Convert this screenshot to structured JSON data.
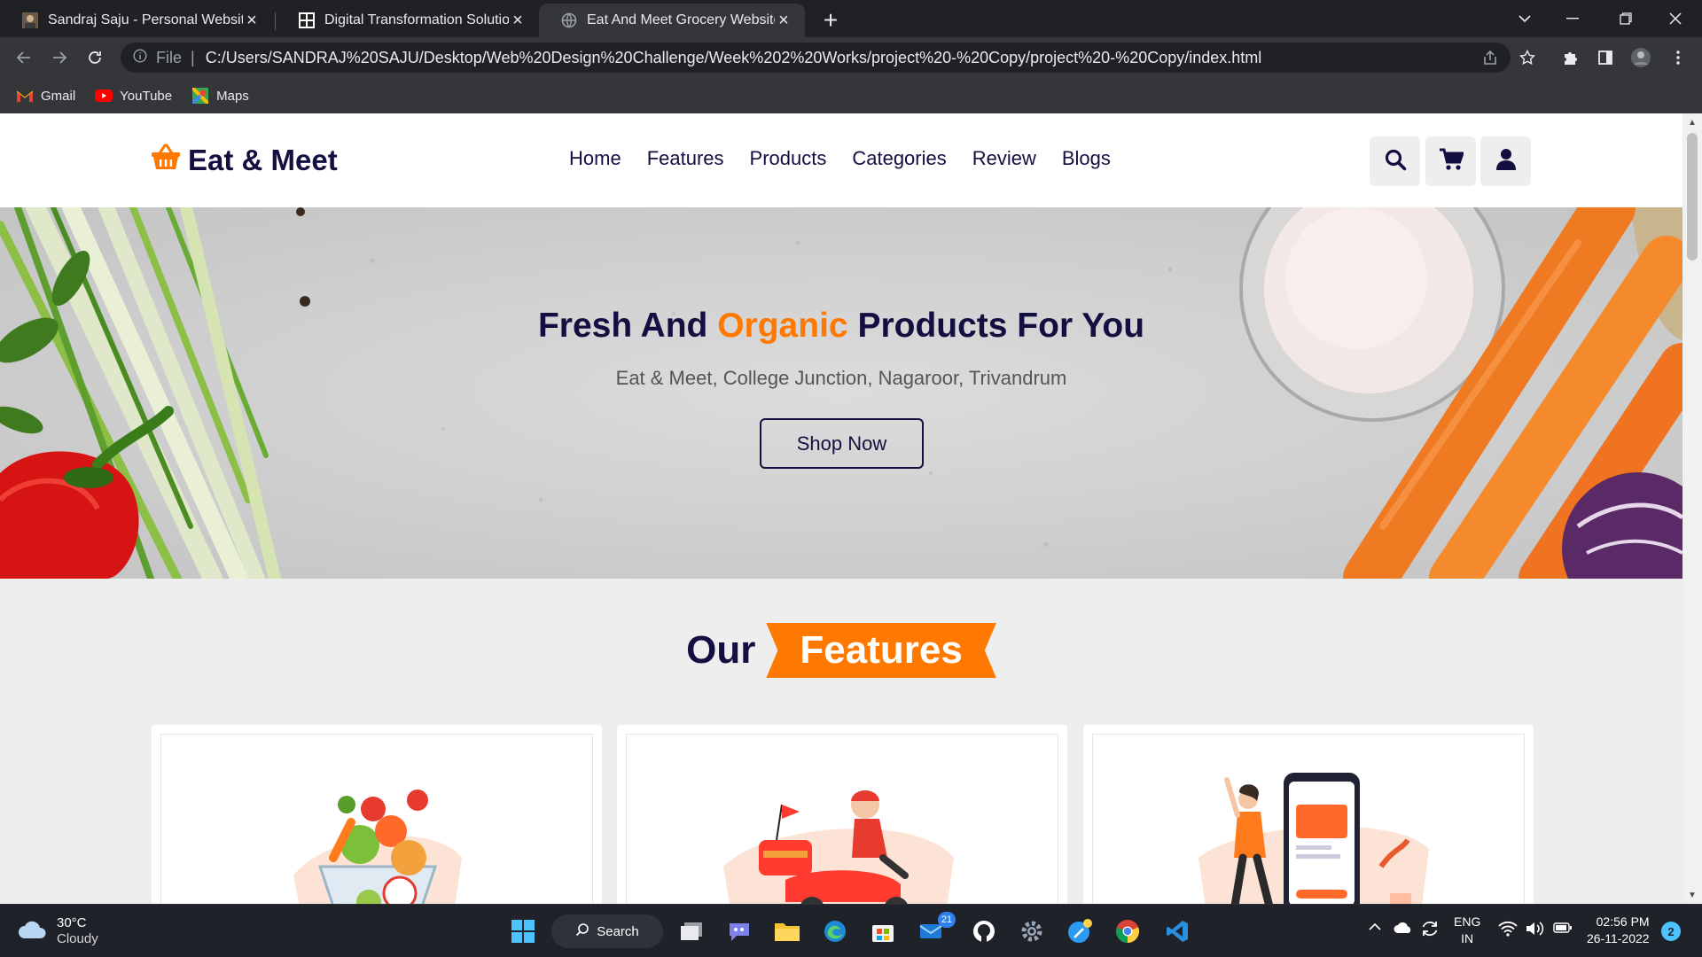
{
  "browser": {
    "tabs": [
      {
        "title": "Sandraj Saju - Personal Website",
        "favicon": "profile-photo-icon",
        "active": false
      },
      {
        "title": "Digital Transformation Solutions",
        "favicon": "ust-logo-icon",
        "active": false
      },
      {
        "title": "Eat And Meet Grocery Website",
        "favicon": "globe-icon",
        "active": true
      }
    ],
    "address": {
      "scheme_label": "File",
      "url": "C:/Users/SANDRAJ%20SAJU/Desktop/Web%20Design%20Challenge/Week%202%20Works/project%20-%20Copy/project%20-%20Copy/index.html"
    },
    "bookmarks": [
      {
        "label": "Gmail",
        "icon": "gmail-icon"
      },
      {
        "label": "YouTube",
        "icon": "youtube-icon"
      },
      {
        "label": "Maps",
        "icon": "maps-icon"
      }
    ]
  },
  "site": {
    "logo_text": "Eat & Meet",
    "nav": [
      "Home",
      "Features",
      "Products",
      "Categories",
      "Review",
      "Blogs"
    ],
    "header_icons": [
      "search-icon",
      "cart-icon",
      "user-icon"
    ],
    "hero": {
      "title_part1": "Fresh And",
      "title_accent": "Organic",
      "title_part2": "Products For You",
      "subtitle": "Eat & Meet, College Junction, Nagaroor, Trivandrum",
      "button": "Shop Now"
    },
    "features_heading": {
      "word1": "Our",
      "word2": "Features"
    },
    "feature_cards": [
      {
        "illustration": "fresh-vegetables-basket-illustration"
      },
      {
        "illustration": "delivery-scooter-illustration"
      },
      {
        "illustration": "mobile-payment-illustration"
      }
    ]
  },
  "taskbar": {
    "weather": {
      "temp": "30°C",
      "desc": "Cloudy"
    },
    "search_label": "Search",
    "store_badge": "21",
    "language": {
      "line1": "ENG",
      "line2": "IN"
    },
    "clock": {
      "time": "02:56 PM",
      "date": "26-11-2022"
    },
    "notifications": "2"
  },
  "colors": {
    "brand_dark": "#130f40",
    "accent_orange": "#ff7800",
    "page_bg": "#eeeeee",
    "chrome_dark": "#202124"
  }
}
